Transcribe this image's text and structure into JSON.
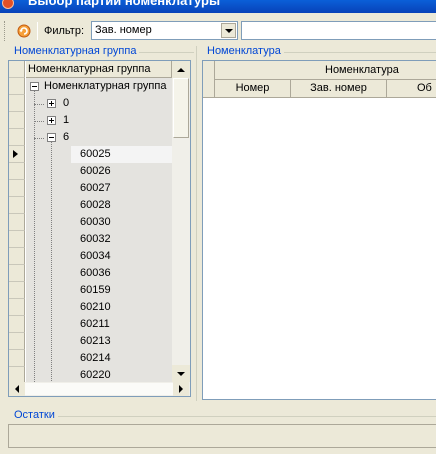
{
  "window": {
    "title": "Выбор партий номенклатуры"
  },
  "toolbar": {
    "refresh_icon": "refresh-icon",
    "filter_label": "Фильтр:",
    "filter_value": "Зав. номер",
    "filter_text": ""
  },
  "groups": {
    "left_caption": "Номенклатурная группа",
    "right_caption": "Номенклатура",
    "bottom_caption": "Остатки"
  },
  "tree": {
    "header": "Номенклатурная группа",
    "root": "Номенклатурная группа",
    "nodes": [
      "0",
      "1",
      "6"
    ],
    "children": [
      "60025",
      "60026",
      "60027",
      "60028",
      "60030",
      "60032",
      "60034",
      "60036",
      "60159",
      "60210",
      "60211",
      "60213",
      "60214",
      "60220"
    ]
  },
  "nomenclature": {
    "band_header": "Номенклатура",
    "columns": [
      "Номер",
      "Зав. номер",
      "Об"
    ]
  },
  "colors": {
    "accent": "#0046d5",
    "title_bar": "#0a5fd8"
  }
}
